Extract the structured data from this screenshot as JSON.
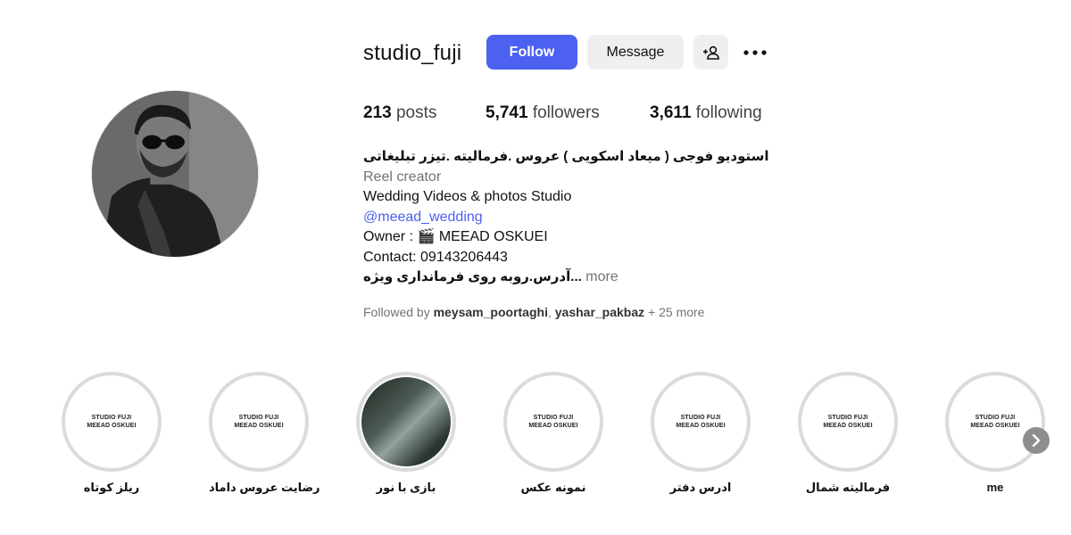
{
  "profile": {
    "username": "studio_fuji",
    "follow_label": "Follow",
    "message_label": "Message",
    "suggest_icon": "person-add-icon",
    "more_icon": "more-horizontal-icon",
    "accent_color": "#4c61f0"
  },
  "stats": {
    "posts_count": "213",
    "posts_label": "posts",
    "followers_count": "5,741",
    "followers_label": "followers",
    "following_count": "3,611",
    "following_label": "following"
  },
  "bio": {
    "name": "استودیو فوجی ( میعاد اسکویی ) عروس .فرمالیته .تیزر تبلیغاتی",
    "category": "Reel creator",
    "line1": "Wedding Videos & photos Studio",
    "mention": "@meead_wedding",
    "owner": "Owner : 🎬 MEEAD OSKUEI",
    "contact": "Contact: 09143206443",
    "address": "آدرس.روبه روی فرمانداری ویژه...",
    "more_label": "more"
  },
  "followed_by": {
    "prefix": "Followed by",
    "user1": "meysam_poortaghi",
    "separator": ",",
    "user2": "yashar_pakbaz",
    "suffix": "+ 25 more"
  },
  "highlights": [
    {
      "line1": "STUDIO FUJI",
      "line2": "MEEAD OSKUEI",
      "label": "ریلز کوتاه"
    },
    {
      "line1": "STUDIO FUJI",
      "line2": "MEEAD OSKUEI",
      "label": "رضایت عروس داماد"
    },
    {
      "line1": "",
      "line2": "",
      "label": "بازی با نور"
    },
    {
      "line1": "STUDIO FUJI",
      "line2": "MEEAD OSKUEI",
      "label": "نمونه عکس"
    },
    {
      "line1": "STUDIO FUJI",
      "line2": "MEEAD OSKUEI",
      "label": "ادرس دفتر"
    },
    {
      "line1": "STUDIO FUJI",
      "line2": "MEEAD OSKUEI",
      "label": "فرمالیته شمال"
    },
    {
      "line1": "STUDIO FUJI",
      "line2": "MEEAD OSKUEI",
      "label": "me"
    }
  ],
  "next_icon": "chevron-right-icon"
}
